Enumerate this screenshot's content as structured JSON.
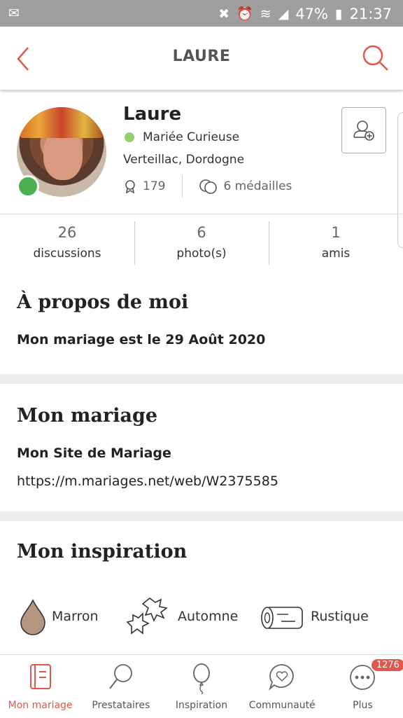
{
  "status_bar": {
    "battery": "47%",
    "time": "21:37"
  },
  "header": {
    "title": "LAURE"
  },
  "profile": {
    "name": "Laure",
    "role": "Mariée Curieuse",
    "location": "Verteillac, Dordogne",
    "points": "179",
    "medals": "6 médailles"
  },
  "counts": [
    {
      "value": "26",
      "label": "discussions"
    },
    {
      "value": "6",
      "label": "photo(s)"
    },
    {
      "value": "1",
      "label": "amis"
    }
  ],
  "about": {
    "title": "À propos de moi",
    "text": "Mon mariage est le 29 Août 2020"
  },
  "wedding": {
    "title": "Mon mariage",
    "site_label": "Mon Site de Mariage",
    "site_url": "https://m.mariages.net/web/W2375585"
  },
  "inspiration": {
    "title": "Mon inspiration",
    "items": [
      {
        "label": "Marron"
      },
      {
        "label": "Automne"
      },
      {
        "label": "Rustique"
      }
    ]
  },
  "tabs": [
    {
      "label": "Mon mariage"
    },
    {
      "label": "Prestataires"
    },
    {
      "label": "Inspiration"
    },
    {
      "label": "Communauté"
    },
    {
      "label": "Plus",
      "badge": "1276"
    }
  ],
  "colors": {
    "accent": "#e2574c",
    "online": "#4caf50",
    "status_bar": "#9e9e9e"
  }
}
